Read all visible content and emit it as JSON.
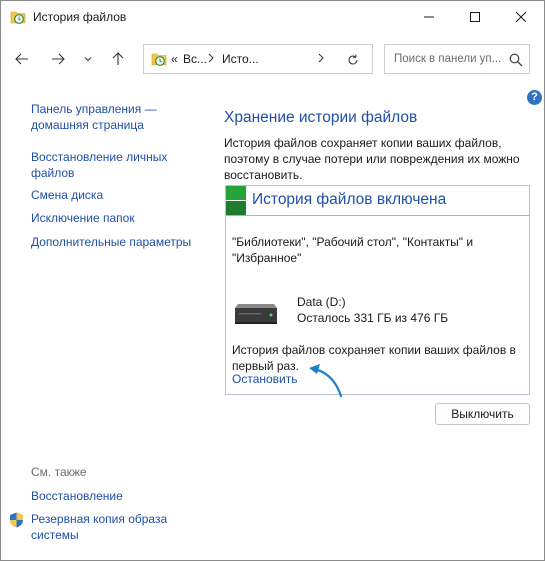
{
  "window": {
    "title": "История файлов"
  },
  "nav": {
    "breadcrumb_more": "«",
    "breadcrumb_1": "Вс...",
    "breadcrumb_2": "Исто...",
    "search_placeholder": "Поиск в панели уп..."
  },
  "sidebar": {
    "home_link": "Панель управления — домашняя страница",
    "items": [
      {
        "label": "Восстановление личных файлов"
      },
      {
        "label": "Смена диска"
      },
      {
        "label": "Исключение папок"
      },
      {
        "label": "Дополнительные параметры"
      }
    ],
    "see_also_title": "См. также",
    "see_also": [
      {
        "label": "Восстановление"
      },
      {
        "label": "Резервная копия образа системы"
      }
    ]
  },
  "main": {
    "title": "Хранение истории файлов",
    "description": "История файлов сохраняет копии ваших файлов, поэтому в случае потери или повреждения их можно восстановить.",
    "status": {
      "heading": "История файлов включена",
      "libraries": "\"Библиотеки\", \"Рабочий стол\", \"Контакты\" и \"Избранное\"",
      "drive_name": "Data (D:)",
      "drive_space": "Осталось 331 ГБ из 476 ГБ",
      "saving_text": "История файлов сохраняет копии ваших файлов в первый раз.",
      "stop_link": "Остановить"
    },
    "turn_off_button": "Выключить",
    "help_glyph": "?"
  },
  "colors": {
    "link": "#1f4fa6",
    "status_green": "#1e8a2e",
    "accent_blue": "#2f73c5"
  }
}
